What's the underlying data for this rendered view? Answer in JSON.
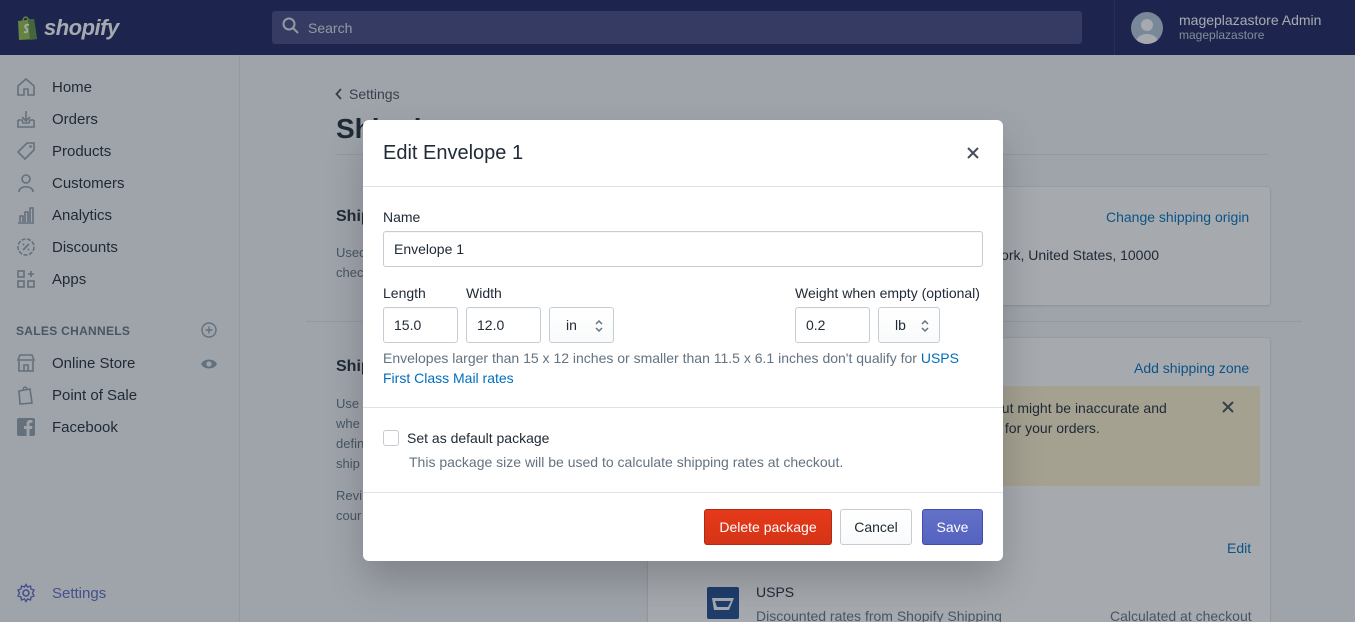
{
  "brand": {
    "name": "shopify"
  },
  "topbar": {
    "search_placeholder": "Search",
    "user_name": "mageplazastore Admin",
    "user_store": "mageplazastore"
  },
  "sidebar": {
    "items": [
      {
        "label": "Home",
        "icon": "home-icon"
      },
      {
        "label": "Orders",
        "icon": "orders-icon"
      },
      {
        "label": "Products",
        "icon": "tag-icon"
      },
      {
        "label": "Customers",
        "icon": "person-icon"
      },
      {
        "label": "Analytics",
        "icon": "bar-chart-icon"
      },
      {
        "label": "Discounts",
        "icon": "discount-icon"
      },
      {
        "label": "Apps",
        "icon": "apps-icon"
      }
    ],
    "sales_channels_title": "SALES CHANNELS",
    "channels": [
      {
        "label": "Online Store",
        "icon": "store-icon"
      },
      {
        "label": "Point of Sale",
        "icon": "pos-icon"
      },
      {
        "label": "Facebook",
        "icon": "facebook-icon"
      }
    ],
    "settings_label": "Settings"
  },
  "background": {
    "back_label": "Settings",
    "title": "Shipping",
    "change_origin": "Change shipping origin",
    "origin_address": "York, United States, 10000",
    "add_zone": "Add shipping zone",
    "warning_text_1": "but might be inaccurate and",
    "warning_text_2": "s for your orders.",
    "edit_link": "Edit",
    "carrier_name": "USPS",
    "carrier_desc": "Discounted rates from Shopify Shipping",
    "carrier_rate": "Calculated at checkout",
    "section1_title": "Ship",
    "section1_text_1": "Used",
    "section1_text_2": "chec",
    "section2_title": "Ship",
    "section2_text_1": "Use",
    "section2_text_2": "whe",
    "section2_text_3": "defin",
    "section2_text_4": "ship",
    "section2_text_5": "Revi",
    "section2_text_6": "cour"
  },
  "modal": {
    "title": "Edit Envelope 1",
    "name_label": "Name",
    "name_value": "Envelope 1",
    "length_label": "Length",
    "length_value": "15.0",
    "width_label": "Width",
    "width_value": "12.0",
    "unit_value": "in",
    "weight_label": "Weight when empty (optional)",
    "weight_value": "0.2",
    "weight_unit": "lb",
    "help_text": "Envelopes larger than 15 x 12 inches or smaller than 11.5 x 6.1 inches don't qualify for ",
    "help_link": "USPS First Class Mail rates",
    "default_label": "Set as default package",
    "default_help": "This package size will be used to calculate shipping rates at checkout.",
    "delete_label": "Delete package",
    "cancel_label": "Cancel",
    "save_label": "Save"
  },
  "colors": {
    "topbar": "#1c2260",
    "primary": "#5c6ac4",
    "danger": "#de3618",
    "link": "#006fbb"
  }
}
